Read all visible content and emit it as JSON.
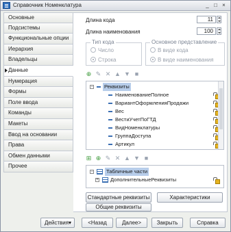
{
  "window": {
    "title": "Справочник Номенклатура",
    "controls": [
      "_",
      "□",
      "×"
    ]
  },
  "nav": {
    "items": [
      {
        "label": "Основные"
      },
      {
        "label": "Подсистемы"
      },
      {
        "label": "Функциональные опции"
      },
      {
        "label": "Иерархия"
      },
      {
        "label": "Владельцы"
      },
      {
        "label": "Данные",
        "active": true
      },
      {
        "label": "Нумерация"
      },
      {
        "label": "Формы"
      },
      {
        "label": "Поле ввода"
      },
      {
        "label": "Команды"
      },
      {
        "label": "Макеты"
      },
      {
        "label": "Ввод на основании"
      },
      {
        "label": "Права"
      },
      {
        "label": "Обмен данными"
      },
      {
        "label": "Прочее"
      }
    ]
  },
  "data_panel": {
    "code_length_label": "Длина кода",
    "code_length_value": "11",
    "name_length_label": "Длина наименования",
    "name_length_value": "100",
    "code_type": {
      "title": "Тип кода",
      "options": [
        "Число",
        "Строка"
      ],
      "selected": "Строка"
    },
    "main_representation": {
      "title": "Основное представление",
      "options": [
        "В виде кода",
        "В виде наименования"
      ],
      "selected": "В виде наименования"
    },
    "attributes_tree": {
      "root": "Реквизиты",
      "items": [
        "НаименованиеПолное",
        "ВариантОформленияПродажи",
        "Вес",
        "ВестиУчетПоГТД",
        "ВидНоменклатуры",
        "ГруппаДоступа",
        "Артикул"
      ]
    },
    "tabular_tree": {
      "root": "Табличные части",
      "items": [
        "ДополнительныеРеквизиты"
      ]
    },
    "buttons": {
      "standard_attributes": "Стандартные реквизиты",
      "characteristics": "Характеристики",
      "common_attributes": "Общие реквизиты"
    }
  },
  "footer": {
    "actions": "Действия",
    "back": "<Назад",
    "next": "Далее>",
    "close": "Закрыть",
    "help": "Справка"
  },
  "colors": {
    "accent": "#3b6fb3",
    "selection": "#b7cdea"
  }
}
